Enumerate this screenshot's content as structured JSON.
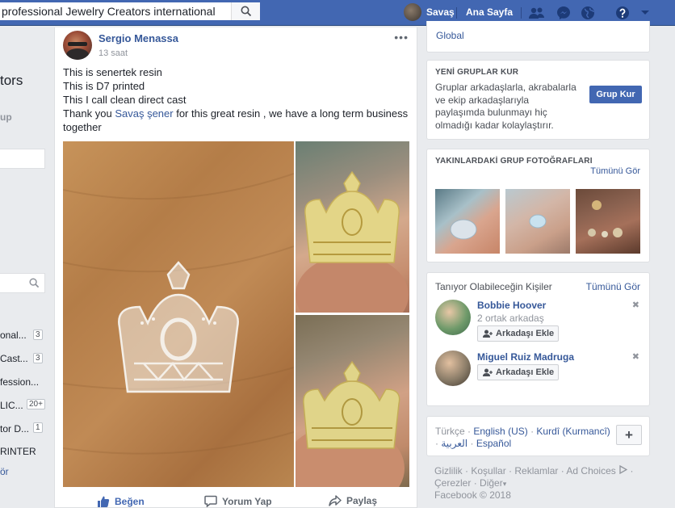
{
  "topbar": {
    "search_value": "professional Jewelry Creators international",
    "user_name": "Savaş",
    "home_label": "Ana Sayfa"
  },
  "left": {
    "title_fragment": "tors",
    "sub_fragment": "up",
    "groups": [
      {
        "label": "onal...",
        "badge": "3"
      },
      {
        "label": " Cast...",
        "badge": "3"
      },
      {
        "label": "fession...",
        "badge": ""
      },
      {
        "label": "LIC...",
        "badge": "20+"
      },
      {
        "label": "tor D...",
        "badge": "1"
      },
      {
        "label": "RINTER",
        "badge": ""
      }
    ],
    "link_fragment": "ör"
  },
  "post": {
    "author": "Sergio Menassa",
    "time": "13 saat",
    "lines": [
      "This is senertek resin",
      "This is D7 printed",
      "This I call clean direct cast"
    ],
    "thanks_prefix": "Thank you ",
    "mention": "Savaş şener",
    "thanks_suffix": " for this great resin , we have a long term business together",
    "actions": {
      "like": "Beğen",
      "comment": "Yorum Yap",
      "share": "Paylaş"
    }
  },
  "right": {
    "top_link": "Global",
    "create_group": {
      "header": "YENİ GRUPLAR KUR",
      "text": "Gruplar arkadaşlarla, akrabalarla ve ekip arkadaşlarıyla paylaşımda bulunmayı hiç olmadığı kadar kolaylaştırır.",
      "button": "Grup Kur"
    },
    "nearby_photos": {
      "header": "YAKINLARDAKİ GRUP FOTOĞRAFLARI",
      "see_all": "Tümünü Gör"
    },
    "people": {
      "header": "Tanıyor Olabileceğin Kişiler",
      "see_all": "Tümünü Gör",
      "items": [
        {
          "name": "Bobbie Hoover",
          "detail": "2 ortak arkadaş",
          "button": "Arkadaşı Ekle"
        },
        {
          "name": "Miguel Ruiz Madruga",
          "detail": "",
          "button": "Arkadaşı Ekle"
        }
      ]
    },
    "languages": {
      "current": "Türkçe",
      "options": [
        "English (US)",
        "Kurdî (Kurmancî)",
        "العربية",
        "Español"
      ],
      "add": "+"
    },
    "footer": {
      "line1": [
        "Gizlilik",
        "Koşullar",
        "Reklamlar",
        "Ad Choices"
      ],
      "line2": [
        "Çerezler",
        "Diğer"
      ],
      "copyright": "Facebook © 2018"
    }
  },
  "colors": {
    "brand": "#4267b2",
    "link": "#365899",
    "bg": "#e9ebee"
  }
}
